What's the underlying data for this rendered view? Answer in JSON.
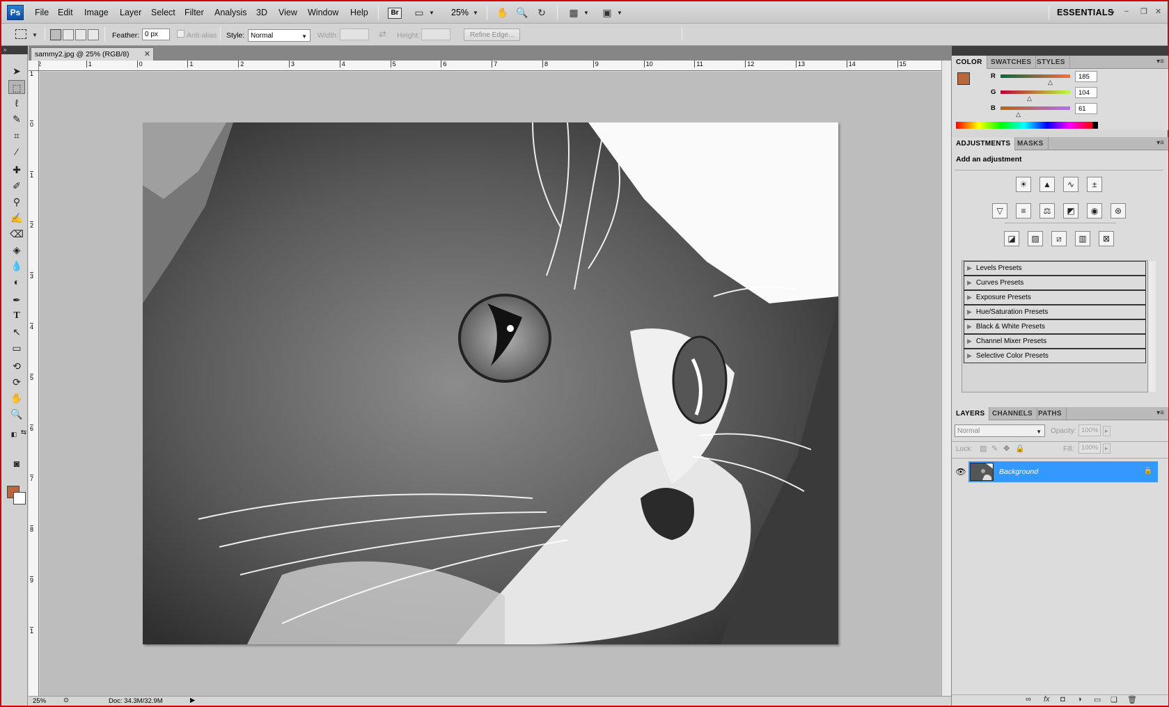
{
  "app": {
    "logo": "Ps"
  },
  "menu": {
    "items": [
      "File",
      "Edit",
      "Image",
      "Layer",
      "Select",
      "Filter",
      "Analysis",
      "3D",
      "View",
      "Window",
      "Help"
    ],
    "bridge_label": "Br",
    "zoom": "25%",
    "workspace": "ESSENTIALS"
  },
  "options": {
    "feather_label": "Feather:",
    "feather_value": "0 px",
    "anti_alias_label": "Anti-alias",
    "style_label": "Style:",
    "style_value": "Normal",
    "width_label": "Width:",
    "height_label": "Height:",
    "refine_edge_label": "Refine Edge..."
  },
  "document": {
    "tab_title": "sammy2.jpg @ 25% (RGB/8)",
    "status_zoom": "25%",
    "status_doc": "Doc: 34.3M/32.9M",
    "ruler_top": [
      "2",
      "1",
      "0",
      "1",
      "2",
      "3",
      "4",
      "5",
      "6",
      "7",
      "8",
      "9",
      "10",
      "11",
      "12",
      "13",
      "14",
      "15"
    ],
    "ruler_left": [
      "1",
      "0",
      "1",
      "2",
      "3",
      "4",
      "5",
      "6",
      "7",
      "8",
      "9",
      "1"
    ]
  },
  "color_panel": {
    "tabs": [
      "COLOR",
      "SWATCHES",
      "STYLES"
    ],
    "r_label": "R",
    "r_value": "185",
    "g_label": "G",
    "g_value": "104",
    "b_label": "B",
    "b_value": "61",
    "foreground": "#b9683d"
  },
  "adjustments_panel": {
    "tabs": [
      "ADJUSTMENTS",
      "MASKS"
    ],
    "heading": "Add an adjustment",
    "presets": [
      "Levels Presets",
      "Curves Presets",
      "Exposure Presets",
      "Hue/Saturation Presets",
      "Black & White Presets",
      "Channel Mixer Presets",
      "Selective Color Presets"
    ]
  },
  "layers_panel": {
    "tabs": [
      "LAYERS",
      "CHANNELS",
      "PATHS"
    ],
    "blend_mode": "Normal",
    "opacity_label": "Opacity:",
    "opacity_value": "100%",
    "lock_label": "Lock:",
    "fill_label": "Fill:",
    "fill_value": "100%",
    "layer_name": "Background"
  }
}
